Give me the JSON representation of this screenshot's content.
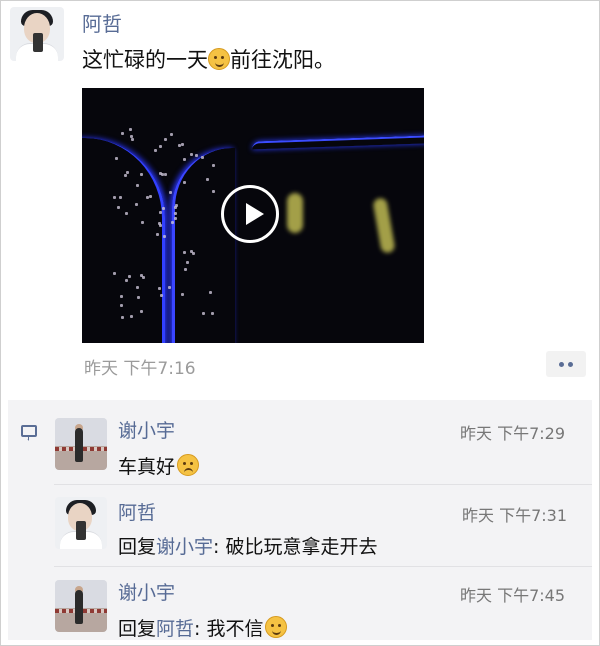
{
  "post": {
    "author": "阿哲",
    "text_before": "这忙碌的一天",
    "text_after": "前往沈阳。",
    "emoji": "smile-emoji",
    "time": "昨天  下午7:16"
  },
  "comments": [
    {
      "name": "谢小宇",
      "time": "昨天 下午7:29",
      "text": "车真好",
      "emoji": "sad-emoji"
    },
    {
      "name": "阿哲",
      "time": "昨天 下午7:31",
      "reply_prefix": "回复",
      "reply_to": "谢小宇",
      "text": ": 破比玩意拿走开去"
    },
    {
      "name": "谢小宇",
      "time": "昨天 下午7:45",
      "reply_prefix": "回复",
      "reply_to": "阿哲",
      "text": ": 我不信",
      "emoji": "sigh-emoji"
    }
  ],
  "colors": {
    "link": "#576b95",
    "meta": "#9b9b9b",
    "comment_bg": "#f3f3f5"
  }
}
